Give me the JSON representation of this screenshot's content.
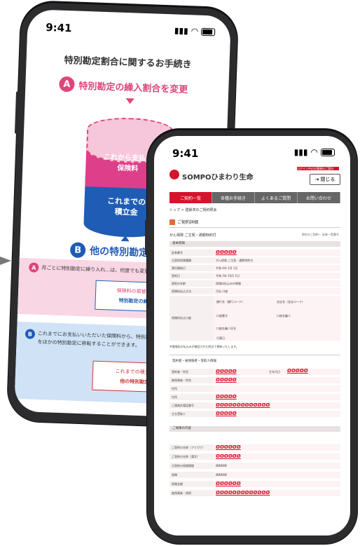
{
  "back_phone": {
    "time": "9:41",
    "page_title": "特別勘定割合に関するお手続き",
    "step_a": {
      "letter": "A",
      "label": "特別勘定の繰入割合を変更"
    },
    "cylinder_top_text": "これから支払う\n保険料",
    "cylinder_bottom_text": "これまでの\n積立金",
    "step_b": {
      "letter": "B",
      "label": "他の特別勘定に移転"
    },
    "pink_box": {
      "letter": "A",
      "text": "月ごとに特別勘定に繰り入れ…は、何度でも変更することができます。",
      "card_line1": "保険料の振替割合を変更する",
      "card_line2": "特別勘定の繰入割合を変更"
    },
    "blue_box": {
      "letter": "B",
      "text": "これまでにお支払いいただいた保険料から、特別勘定へ繰り入れられた金額をほかの特別勘定に移転することができます。",
      "card_line1": "これまでの積立金残高を",
      "card_line2": "他の特別勘定に移転"
    }
  },
  "front_phone": {
    "time": "9:41",
    "brand": "SOMPOひまわり生命",
    "red_tag": "ログイン中のお客様のご案内",
    "logout_label": "閉じる",
    "nav": [
      "ご契約一覧",
      "各種お手続き",
      "よくあるご質問",
      "お問い合わせ"
    ],
    "breadcrumb": "トップ > 登録済のご契約照会",
    "section_title": "ご契約詳細",
    "product_title": "がん保険 ご主契・通期特約付",
    "product_right": "現在のご契約一 証券一覧番号",
    "bars": [
      "基本情報",
      "契約者・被保険者・受取人情報",
      "ご保障の内容"
    ],
    "basic_rows": [
      {
        "k": "証券番号",
        "v": "ØØØØØ"
      },
      {
        "k": "主契約保険種類",
        "v": "がん保険 ご主契・通期特約付"
      },
      {
        "k": "責任開始日",
        "v": "令和 4年 1月 1日"
      },
      {
        "k": "契約日",
        "v": "令和 3年 10月 1日"
      },
      {
        "k": "契約の年齢",
        "v": "保険料払込みの期間"
      },
      {
        "k": "保険料払込方法",
        "v": "月払 口座"
      }
    ],
    "payment_cells": [
      "銀行名（銀行コード）",
      "支店名（支店コード）",
      "口座番号",
      "口座名義人",
      "口座名義人氏名",
      "引落日"
    ],
    "payment_label": "保険料払込口座",
    "contractor_rows": [
      {
        "k": "契約者・性別",
        "v": "ØØØØØ"
      },
      {
        "k": "被保険者・性別",
        "v": "ØØØØØ"
      },
      {
        "k": "住所",
        "v": "ØØØØØ"
      },
      {
        "k": "ご連絡先電話番号",
        "v": "ØØØØØØØØØØØØØ"
      },
      {
        "k": "主な受取人",
        "v": "ØØØØØ"
      }
    ],
    "dob_label": "生年月日",
    "dob_value": "ØØØØØ",
    "coverage_rows": [
      {
        "k": "ご契約の名称（フリガナ）",
        "v": "ØØØØØØ"
      },
      {
        "k": "ご契約の名称（漢字）",
        "v": "ØØØØØØ"
      },
      {
        "k": "主契約の保険期間",
        "v": "ØØØØØ"
      },
      {
        "k": "保障",
        "v": "ØØØØØ"
      },
      {
        "k": "保険金額",
        "v": "ØØØØØØ"
      },
      {
        "k": "被保険者・続柄",
        "v": "ØØØØØØØØØØØØØ"
      }
    ],
    "footnote": "※保険料の払込みが確認された時点で更新いたします。"
  }
}
